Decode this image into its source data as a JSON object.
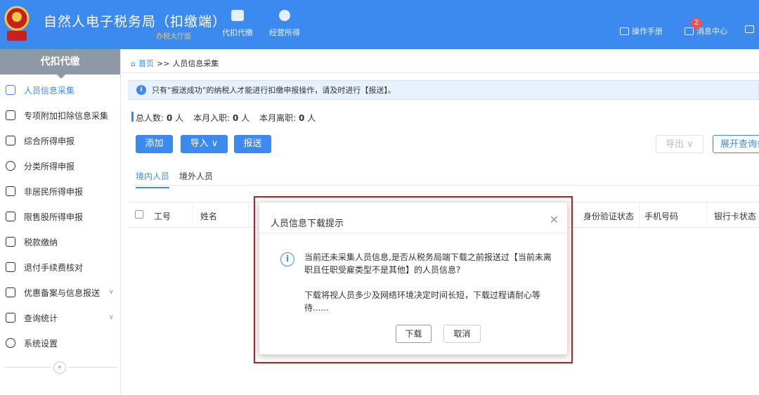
{
  "header": {
    "title": "自然人电子税务局（扣缴端）",
    "subtitle": "办税大厅版",
    "nav": [
      {
        "label": "代扣代缴",
        "icon": "wallet-icon"
      },
      {
        "label": "经营所得",
        "icon": "coin-stack-icon"
      }
    ],
    "links": {
      "manual": "操作手册",
      "messages": "消息中心"
    },
    "message_count": "2"
  },
  "sidebar": {
    "title": "代扣代缴",
    "items": [
      {
        "label": "人员信息采集",
        "icon": "person-icon",
        "active": true
      },
      {
        "label": "专项附加扣除信息采集",
        "icon": "list-icon"
      },
      {
        "label": "综合所得申报",
        "icon": "layers-icon"
      },
      {
        "label": "分类所得申报",
        "icon": "clock-icon"
      },
      {
        "label": "非居民所得申报",
        "icon": "person-outline-icon"
      },
      {
        "label": "限售股所得申报",
        "icon": "bar-chart-icon"
      },
      {
        "label": "税款缴纳",
        "icon": "folder-icon"
      },
      {
        "label": "退付手续费核对",
        "icon": "receipt-icon"
      },
      {
        "label": "优惠备案与信息报送",
        "icon": "document-icon",
        "expandable": true
      },
      {
        "label": "查询统计",
        "icon": "search-list-icon",
        "expandable": true
      },
      {
        "label": "系统设置",
        "icon": "gear-icon"
      }
    ],
    "collapse_label": "«"
  },
  "breadcrumb": {
    "home": "首页",
    "sep": ">>",
    "current": "人员信息采集"
  },
  "notice": "只有“报送成功”的纳税人才能进行扣缴申报操作，请及时进行【报送】。",
  "stats": {
    "total_label": "总人数:",
    "total_value": "0",
    "unit": "人",
    "hired_label": "本月入职:",
    "hired_value": "0",
    "left_label": "本月离职:",
    "left_value": "0"
  },
  "toolbar": {
    "add": "添加",
    "import": "导入 ∨",
    "submit": "报送",
    "export": "导出 ∨",
    "expand_query": "展开查询条件"
  },
  "tabs": [
    {
      "label": "境内人员",
      "active": true
    },
    {
      "label": "境外人员"
    }
  ],
  "table": {
    "columns": [
      "工号",
      "姓名",
      "身份验证状态",
      "手机号码",
      "银行卡状态"
    ]
  },
  "dialog": {
    "title": "人员信息下载提示",
    "message1": "当前还未采集人员信息,是否从税务局端下载之前报送过【当前未离职且任职受雇类型不是其他】的人员信息?",
    "message2": "下载将视人员多少及网络环境决定时间长短，下载过程请耐心等待......",
    "ok": "下载",
    "cancel": "取消"
  }
}
